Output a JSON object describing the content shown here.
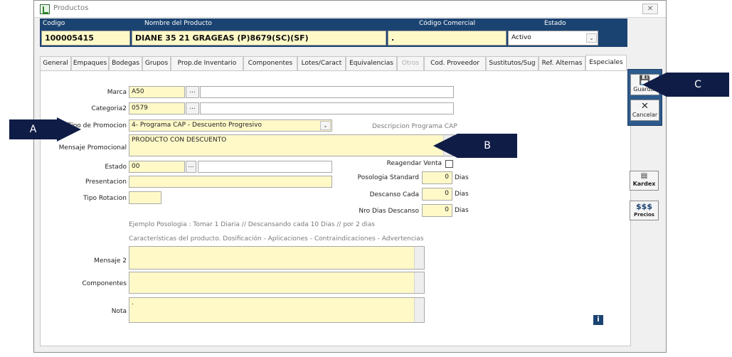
{
  "window": {
    "title": "Productos",
    "close_label": "✕"
  },
  "header": {
    "labels": {
      "code": "Codigo",
      "name": "Nombre del Producto",
      "commercial_code": "Código Comercial",
      "status": "Estado"
    },
    "values": {
      "code": "100005415",
      "name": "DIANE 35 21 GRAGEAS (P)8679(SC)(SF)",
      "commercial_code": ".",
      "status": "Activo"
    }
  },
  "tabs": [
    {
      "label": "General",
      "state": "normal"
    },
    {
      "label": "Empaques",
      "state": "normal"
    },
    {
      "label": "Bodegas",
      "state": "normal"
    },
    {
      "label": "Grupos",
      "state": "normal"
    },
    {
      "label": "Prop.de Inventario",
      "state": "normal"
    },
    {
      "label": "Componentes",
      "state": "normal"
    },
    {
      "label": "Lotes/Caract",
      "state": "normal"
    },
    {
      "label": "Equivalencias",
      "state": "normal"
    },
    {
      "label": "Otros",
      "state": "disabled"
    },
    {
      "label": "Cod. Proveedor",
      "state": "normal"
    },
    {
      "label": "Sustitutos/Sug",
      "state": "normal"
    },
    {
      "label": "Ref. Alternas",
      "state": "normal"
    },
    {
      "label": "Especiales",
      "state": "active"
    }
  ],
  "form": {
    "marca": {
      "label": "Marca",
      "value": "A50",
      "desc": ""
    },
    "categoria2": {
      "label": "Categoria2",
      "value": "0579",
      "desc": ""
    },
    "tipo_promocion": {
      "label": "Tipo de Promocion",
      "value": "4- Programa CAP - Descuento  Progresivo"
    },
    "descripcion_cap": "Descripcion Programa CAP",
    "mensaje_promocional": {
      "label": "Mensaje Promocional",
      "value": "PRODUCTO CON DESCUENTO"
    },
    "estado": {
      "label": "Estado",
      "value": "00",
      "desc": ""
    },
    "presentacion": {
      "label": "Presentacion",
      "value": ""
    },
    "tipo_rotacion": {
      "label": "Tipo Rotacion",
      "value": ""
    },
    "reagendar_venta": {
      "label": "Reagendar Venta",
      "checked": false
    },
    "posologia_standard": {
      "label": "Posologia Standard",
      "value": "0",
      "unit": "Dias"
    },
    "descanso_cada": {
      "label": "Descanso Cada",
      "value": "0",
      "unit": "Dias"
    },
    "nro_dias_descanso": {
      "label": "Nro Dias Descanso",
      "value": "0",
      "unit": "Dias"
    },
    "ejemplo_posologia": "Ejemplo Posologia : Tomar  1 Diaria  // Descansando  cada  10 Dias //  por 2 dias",
    "caracteristicas": "Características del producto.  Dosificación - Aplicaciones - Contraindicaciones - Advertencias",
    "mensaje2": {
      "label": "Mensaje 2",
      "value": ""
    },
    "componentes": {
      "label": "Componentes",
      "value": ""
    },
    "nota": {
      "label": "Nota",
      "value": "."
    },
    "dots_label": "..."
  },
  "toolbar": {
    "guardar": "Guardar",
    "cancelar": "Cancelar",
    "kardex": "Kardex",
    "precios_symbol": "$$$",
    "precios": "Precios",
    "info": "i"
  },
  "callouts": {
    "a": "A",
    "b": "B",
    "c": "C"
  },
  "icons": [
    "app-icon",
    "close-icon",
    "chevron-down-icon",
    "save-icon",
    "cancel-icon",
    "kardex-icon",
    "dollar-icon",
    "info-icon"
  ],
  "colors": {
    "header_bg": "#1b4371",
    "field_bg": "#fff9c8",
    "callout_bg": "#0f1d46",
    "toolbar_bg": "#2d5a8c"
  }
}
